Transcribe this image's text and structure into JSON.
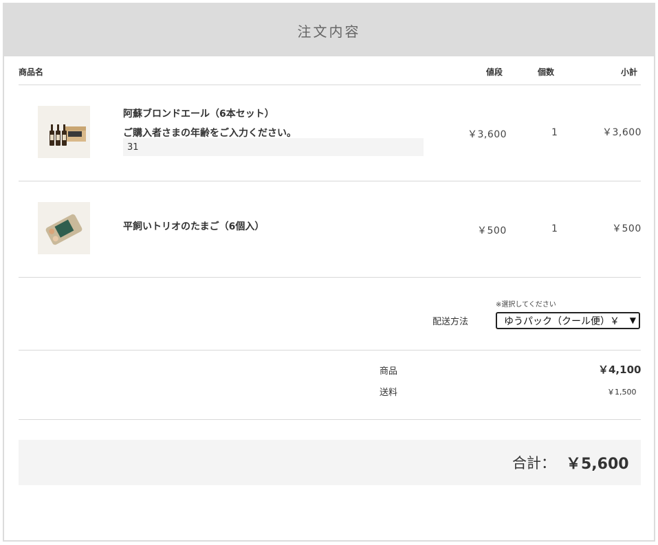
{
  "header": {
    "title": "注文内容"
  },
  "columns": {
    "name": "商品名",
    "price": "値段",
    "qty": "個数",
    "subtotal": "小計"
  },
  "items": [
    {
      "name": "阿蘇ブロンドエール（6本セット）",
      "note": "ご購入者さまの年齢をご入力ください。",
      "age_value": "31",
      "price": "￥3,600",
      "qty": "1",
      "subtotal": "￥3,600",
      "icon": "beer-bottles-icon"
    },
    {
      "name": "平飼いトリオのたまご（6個入）",
      "price": "￥500",
      "qty": "1",
      "subtotal": "￥500",
      "icon": "egg-carton-icon"
    }
  ],
  "shipping": {
    "hint": "※選択してください",
    "label": "配送方法",
    "selected": "ゆうパック（クール便）￥"
  },
  "summary": {
    "goods_label": "商品",
    "goods_value": "￥4,100",
    "shipping_label": "送料",
    "shipping_value": "￥1,500"
  },
  "total": {
    "label": "合計：",
    "value": "￥5,600"
  },
  "colors": {
    "header_bg": "#dcdcdc",
    "total_bg": "#f4f4f4",
    "rule": "#d8d8d8"
  }
}
